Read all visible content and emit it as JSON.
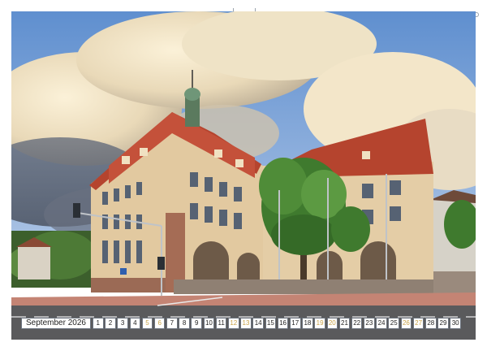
{
  "calendar": {
    "month_label": "September 2026",
    "days": [
      "1",
      "2",
      "3",
      "4",
      "5",
      "6",
      "7",
      "8",
      "9",
      "10",
      "11",
      "12",
      "13",
      "14",
      "15",
      "16",
      "17",
      "18",
      "19",
      "20",
      "21",
      "22",
      "23",
      "24",
      "25",
      "26",
      "27",
      "28",
      "29",
      "30"
    ],
    "weekend_days": [
      "5",
      "6",
      "12",
      "13",
      "19",
      "20",
      "26",
      "27"
    ]
  },
  "colors": {
    "sky": "#6f9bd6",
    "facade": "#e2c9a0",
    "roof": "#b5442e",
    "tree": "#3f7a2e",
    "road": "#5a5a5c",
    "weekend_text": "#c9a34a"
  }
}
